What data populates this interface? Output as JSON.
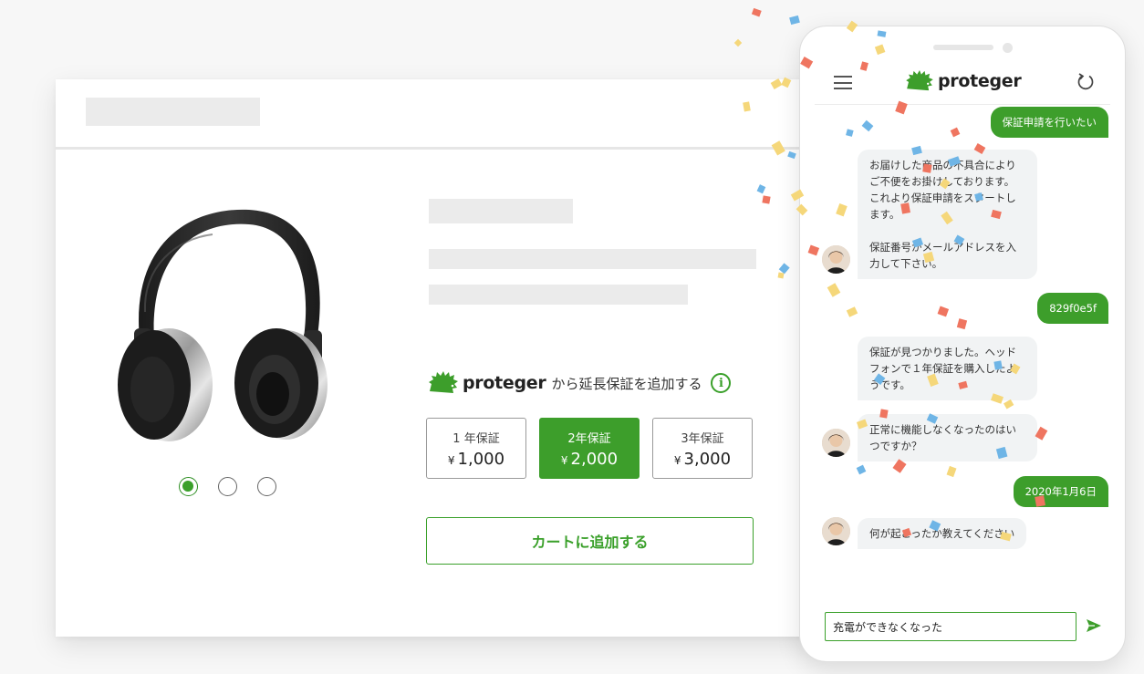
{
  "colors": {
    "brand_green": "#3d9e2b",
    "placeholder_gray": "#ebebeb",
    "bot_bubble": "#f1f3f4"
  },
  "product": {
    "brand_name": "proteger",
    "brand_tagline": "から延長保証を追加する",
    "info_icon": "i",
    "image_icon": "headphones-icon",
    "carousel_count": 3,
    "carousel_active": 1,
    "plans": [
      {
        "label": "1 年保証",
        "currency": "¥",
        "price": "1,000",
        "selected": false
      },
      {
        "label": "2年保証",
        "currency": "¥",
        "price": "2,000",
        "selected": true
      },
      {
        "label": "3年保証",
        "currency": "¥",
        "price": "3,000",
        "selected": false
      }
    ],
    "add_to_cart_label": "カートに追加する"
  },
  "chat": {
    "brand_name": "proteger",
    "menu_icon": "hamburger-menu-icon",
    "refresh_icon": "refresh-icon",
    "messages": [
      {
        "from": "user",
        "text": "保証申請を行いたい"
      },
      {
        "from": "bot",
        "text": "お届けした商品の不具合により\nご不便をお掛けしております。\nこれより保証申請をスタートし\nます。\n\n保証番号かメールアドレスを入\n力して下さい。"
      },
      {
        "from": "user",
        "text": "829f0e5f"
      },
      {
        "from": "bot",
        "text": "保証が見つかりました。ヘッド\nフォンで１年保証を購入したよ\nうです。"
      },
      {
        "from": "bot",
        "text": "正常に機能しなくなったのはい\nつですか？"
      },
      {
        "from": "user",
        "text": "2020年1月6日"
      },
      {
        "from": "bot",
        "text": "何が起こったか教えてください"
      }
    ],
    "input_value": "充電ができなくなった",
    "send_icon": "send-icon"
  }
}
